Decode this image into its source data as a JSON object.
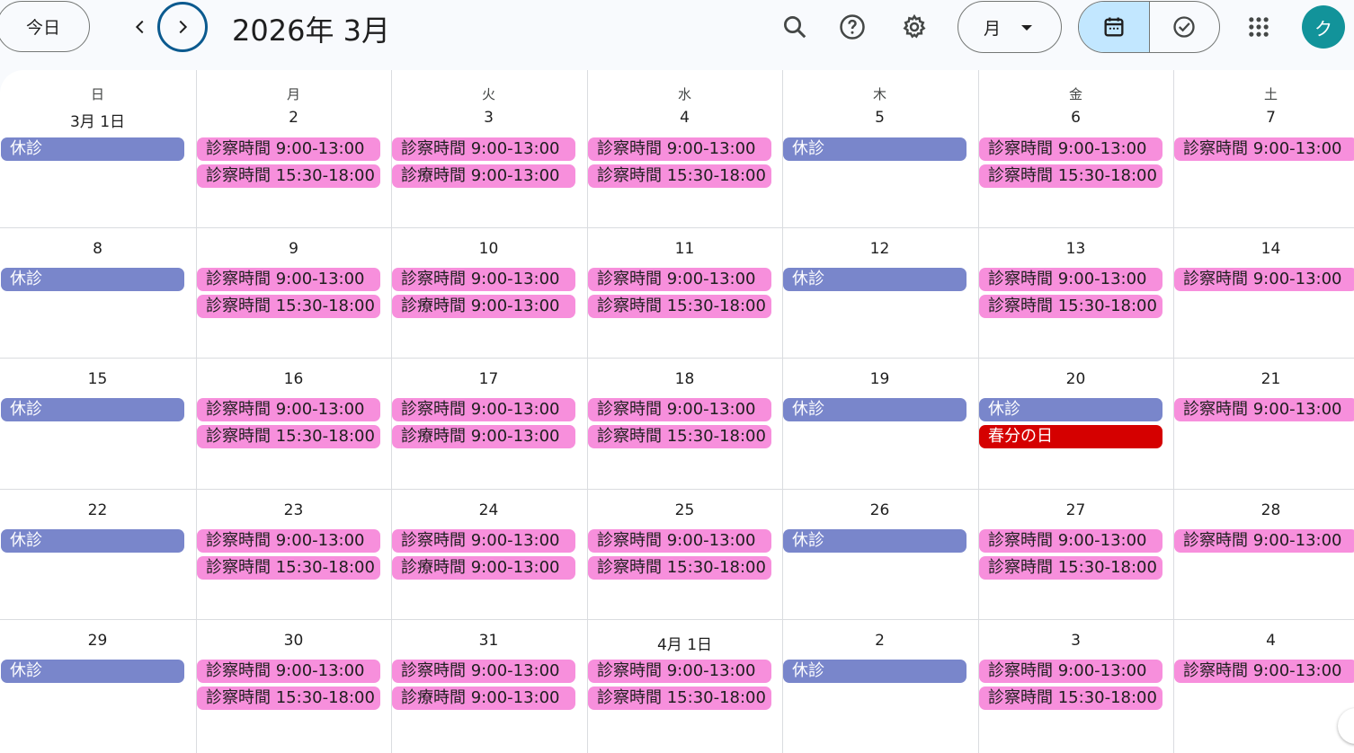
{
  "toolbar": {
    "today_label": "今日",
    "month_title": "2026年 3月",
    "view_label": "月",
    "avatar_letter": "ク"
  },
  "icons": {
    "prev": "chevron-left-icon",
    "next": "chevron-right-icon",
    "search": "search-icon",
    "help": "help-icon",
    "settings": "gear-icon",
    "calendar_view": "calendar-icon",
    "tasks_view": "task-check-icon",
    "apps": "apps-grid-icon"
  },
  "colors": {
    "closed": "#7986cb",
    "hours": "#f78fdc",
    "holiday": "#d50000",
    "accent_toggle": "#c2e7ff",
    "avatar": "#12939a"
  },
  "weekdays": [
    "日",
    "月",
    "火",
    "水",
    "木",
    "金",
    "土"
  ],
  "weeks": [
    [
      {
        "day": "3月 1日",
        "events": [
          {
            "type": "closed",
            "text": "休診"
          }
        ]
      },
      {
        "day": "2",
        "events": [
          {
            "type": "hours",
            "text": "診察時間 9:00-13:00"
          },
          {
            "type": "hours",
            "text": "診察時間 15:30-18:00"
          }
        ]
      },
      {
        "day": "3",
        "events": [
          {
            "type": "hours",
            "text": "診察時間 9:00-13:00"
          },
          {
            "type": "hours",
            "text": "診療時間 9:00-13:00"
          }
        ]
      },
      {
        "day": "4",
        "events": [
          {
            "type": "hours",
            "text": "診察時間 9:00-13:00"
          },
          {
            "type": "hours",
            "text": "診察時間 15:30-18:00"
          }
        ]
      },
      {
        "day": "5",
        "events": [
          {
            "type": "closed",
            "text": "休診"
          }
        ]
      },
      {
        "day": "6",
        "events": [
          {
            "type": "hours",
            "text": "診察時間 9:00-13:00"
          },
          {
            "type": "hours",
            "text": "診察時間 15:30-18:00"
          }
        ]
      },
      {
        "day": "7",
        "events": [
          {
            "type": "hours",
            "text": "診察時間 9:00-13:00"
          }
        ]
      }
    ],
    [
      {
        "day": "8",
        "events": [
          {
            "type": "closed",
            "text": "休診"
          }
        ]
      },
      {
        "day": "9",
        "events": [
          {
            "type": "hours",
            "text": "診察時間 9:00-13:00"
          },
          {
            "type": "hours",
            "text": "診察時間 15:30-18:00"
          }
        ]
      },
      {
        "day": "10",
        "events": [
          {
            "type": "hours",
            "text": "診察時間 9:00-13:00"
          },
          {
            "type": "hours",
            "text": "診療時間 9:00-13:00"
          }
        ]
      },
      {
        "day": "11",
        "events": [
          {
            "type": "hours",
            "text": "診察時間 9:00-13:00"
          },
          {
            "type": "hours",
            "text": "診察時間 15:30-18:00"
          }
        ]
      },
      {
        "day": "12",
        "events": [
          {
            "type": "closed",
            "text": "休診"
          }
        ]
      },
      {
        "day": "13",
        "events": [
          {
            "type": "hours",
            "text": "診察時間 9:00-13:00"
          },
          {
            "type": "hours",
            "text": "診察時間 15:30-18:00"
          }
        ]
      },
      {
        "day": "14",
        "events": [
          {
            "type": "hours",
            "text": "診察時間 9:00-13:00"
          }
        ]
      }
    ],
    [
      {
        "day": "15",
        "events": [
          {
            "type": "closed",
            "text": "休診"
          }
        ]
      },
      {
        "day": "16",
        "events": [
          {
            "type": "hours",
            "text": "診察時間 9:00-13:00"
          },
          {
            "type": "hours",
            "text": "診察時間 15:30-18:00"
          }
        ]
      },
      {
        "day": "17",
        "events": [
          {
            "type": "hours",
            "text": "診察時間 9:00-13:00"
          },
          {
            "type": "hours",
            "text": "診療時間 9:00-13:00"
          }
        ]
      },
      {
        "day": "18",
        "events": [
          {
            "type": "hours",
            "text": "診察時間 9:00-13:00"
          },
          {
            "type": "hours",
            "text": "診察時間 15:30-18:00"
          }
        ]
      },
      {
        "day": "19",
        "events": [
          {
            "type": "closed",
            "text": "休診"
          }
        ]
      },
      {
        "day": "20",
        "events": [
          {
            "type": "closed",
            "text": "休診"
          },
          {
            "type": "holiday",
            "text": "春分の日"
          }
        ]
      },
      {
        "day": "21",
        "events": [
          {
            "type": "hours",
            "text": "診察時間 9:00-13:00"
          }
        ]
      }
    ],
    [
      {
        "day": "22",
        "events": [
          {
            "type": "closed",
            "text": "休診"
          }
        ]
      },
      {
        "day": "23",
        "events": [
          {
            "type": "hours",
            "text": "診察時間 9:00-13:00"
          },
          {
            "type": "hours",
            "text": "診察時間 15:30-18:00"
          }
        ]
      },
      {
        "day": "24",
        "events": [
          {
            "type": "hours",
            "text": "診察時間 9:00-13:00"
          },
          {
            "type": "hours",
            "text": "診療時間 9:00-13:00"
          }
        ]
      },
      {
        "day": "25",
        "events": [
          {
            "type": "hours",
            "text": "診察時間 9:00-13:00"
          },
          {
            "type": "hours",
            "text": "診察時間 15:30-18:00"
          }
        ]
      },
      {
        "day": "26",
        "events": [
          {
            "type": "closed",
            "text": "休診"
          }
        ]
      },
      {
        "day": "27",
        "events": [
          {
            "type": "hours",
            "text": "診察時間 9:00-13:00"
          },
          {
            "type": "hours",
            "text": "診察時間 15:30-18:00"
          }
        ]
      },
      {
        "day": "28",
        "events": [
          {
            "type": "hours",
            "text": "診察時間 9:00-13:00"
          }
        ]
      }
    ],
    [
      {
        "day": "29",
        "events": [
          {
            "type": "closed",
            "text": "休診"
          }
        ]
      },
      {
        "day": "30",
        "events": [
          {
            "type": "hours",
            "text": "診察時間 9:00-13:00"
          },
          {
            "type": "hours",
            "text": "診察時間 15:30-18:00"
          }
        ]
      },
      {
        "day": "31",
        "events": [
          {
            "type": "hours",
            "text": "診察時間 9:00-13:00"
          },
          {
            "type": "hours",
            "text": "診療時間 9:00-13:00"
          }
        ]
      },
      {
        "day": "4月 1日",
        "events": [
          {
            "type": "hours",
            "text": "診察時間 9:00-13:00"
          },
          {
            "type": "hours",
            "text": "診察時間 15:30-18:00"
          }
        ]
      },
      {
        "day": "2",
        "events": [
          {
            "type": "closed",
            "text": "休診"
          }
        ]
      },
      {
        "day": "3",
        "events": [
          {
            "type": "hours",
            "text": "診察時間 9:00-13:00"
          },
          {
            "type": "hours",
            "text": "診察時間 15:30-18:00"
          }
        ]
      },
      {
        "day": "4",
        "events": [
          {
            "type": "hours",
            "text": "診察時間 9:00-13:00"
          }
        ]
      }
    ]
  ]
}
